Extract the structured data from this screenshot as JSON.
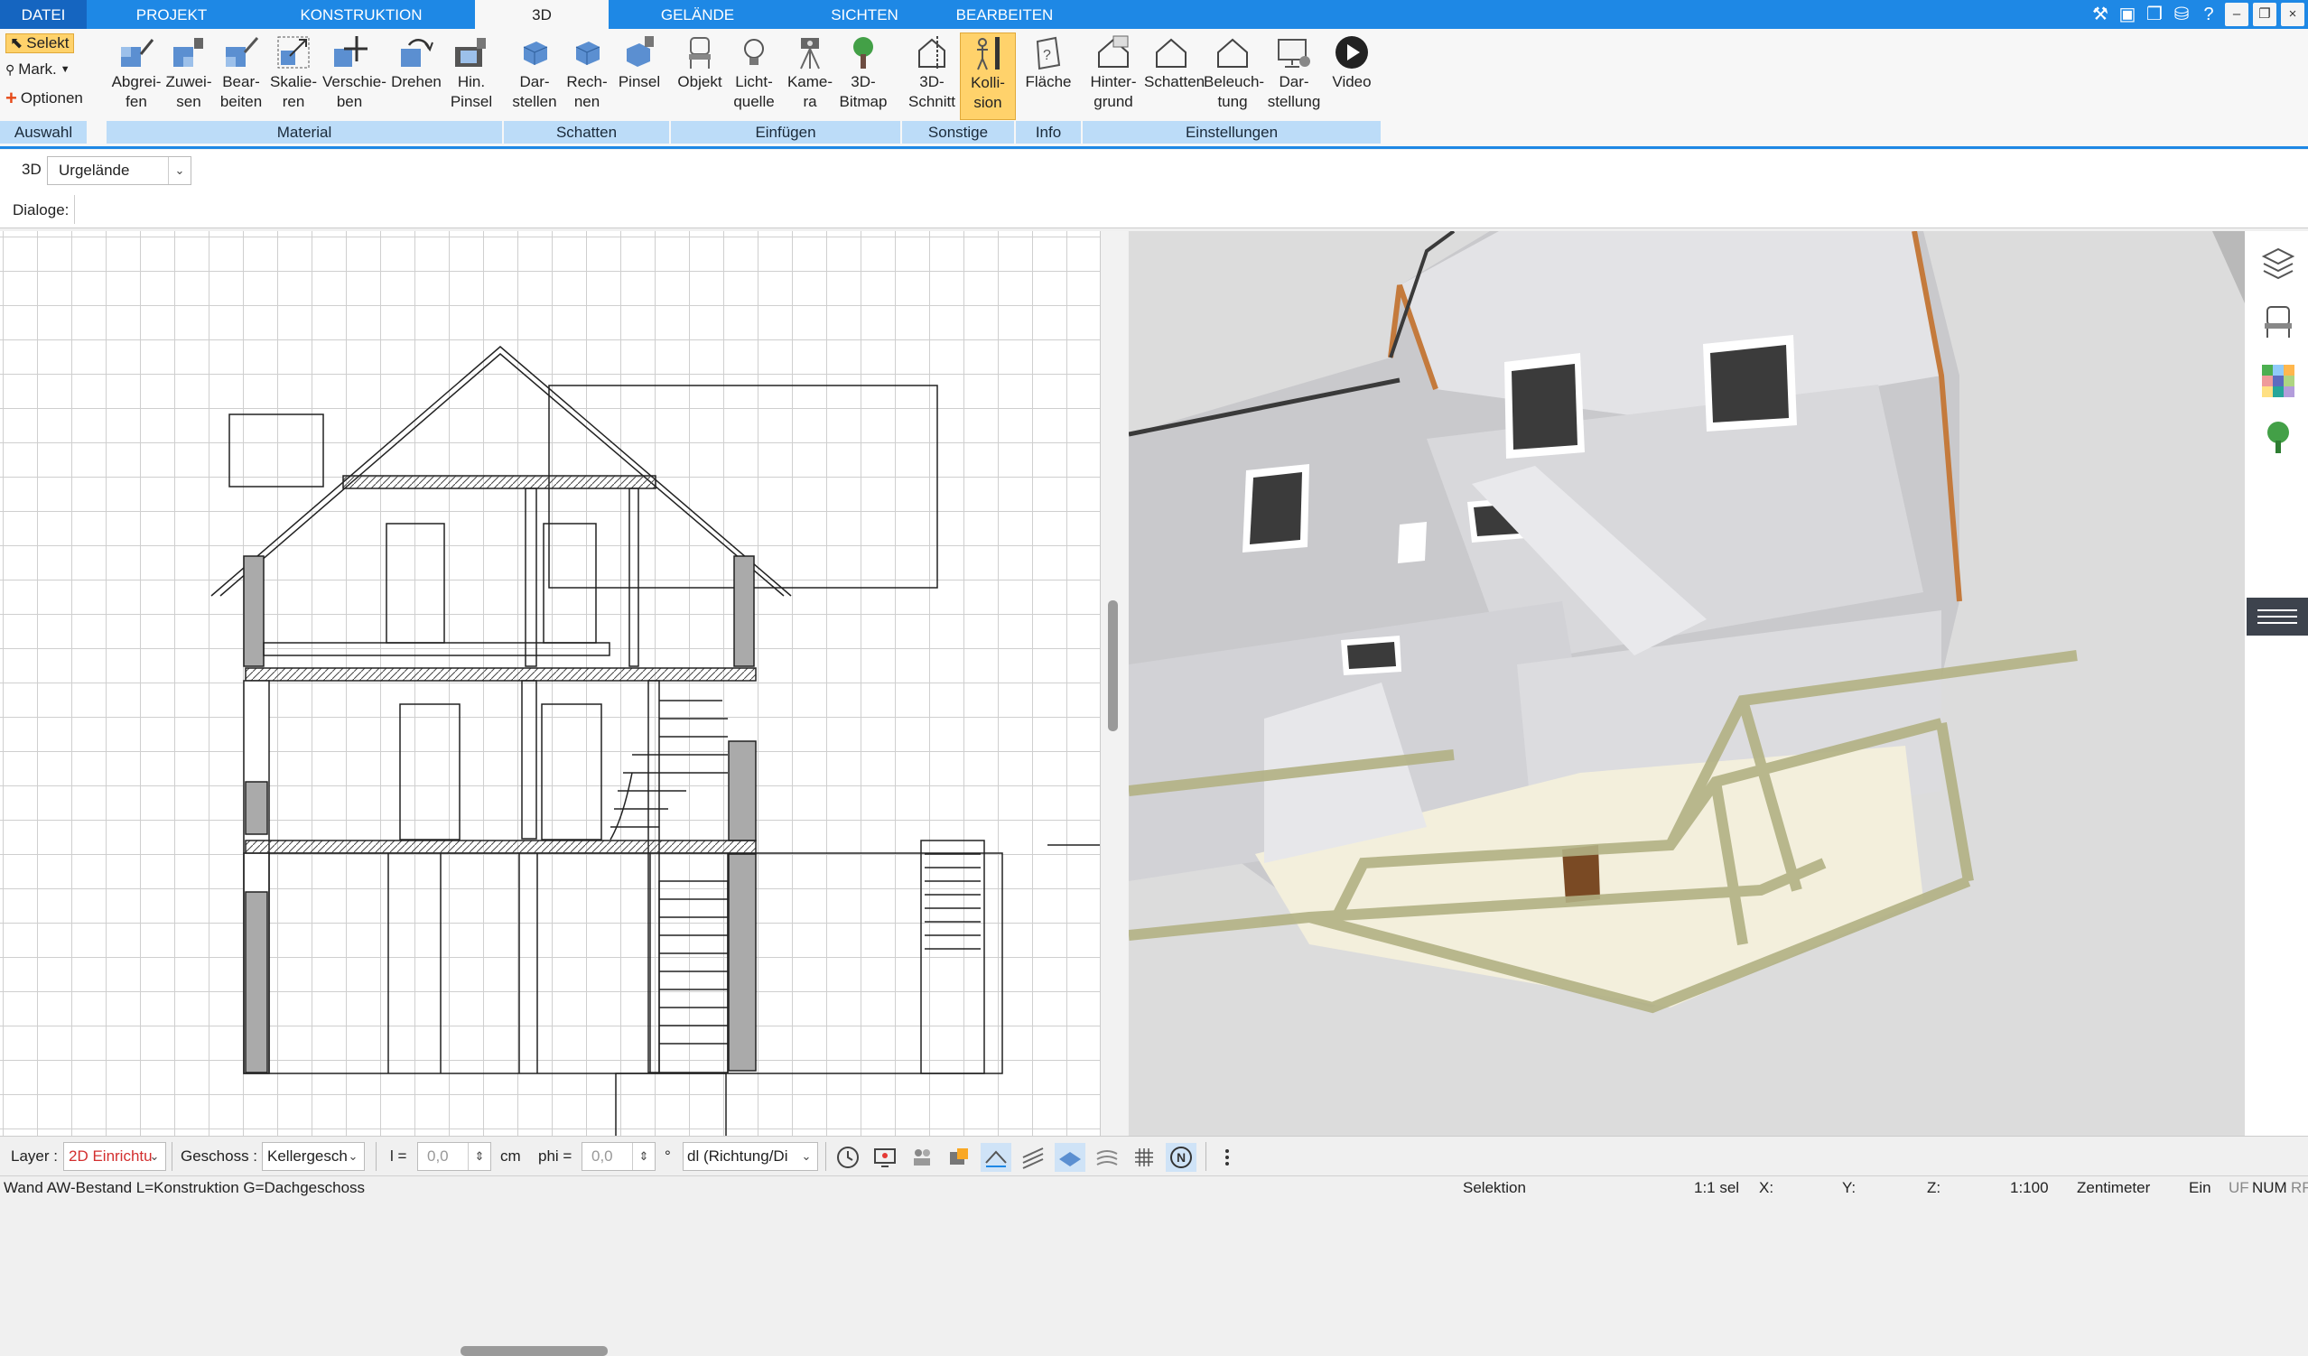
{
  "tabs": [
    "DATEI",
    "PROJEKT",
    "KONSTRUKTION",
    "3D",
    "GELÄNDE",
    "SICHTEN",
    "BEARBEITEN"
  ],
  "active_tab": "3D",
  "ribbon": {
    "auswahl": {
      "label": "Auswahl",
      "selekt": "Selekt",
      "mark": "Mark.",
      "optionen": "Optionen"
    },
    "material": {
      "label": "Material",
      "buttons": [
        "Abgrei-\nfen",
        "Zuwei-\nsen",
        "Bear-\nbeiten",
        "Skalie-\nren",
        "Verschie-\nben",
        "Drehen",
        "Hin.\nPinsel"
      ]
    },
    "schatten": {
      "label": "Schatten",
      "buttons": [
        "Dar-\nstellen",
        "Rech-\nnen",
        "Pinsel"
      ]
    },
    "einfuegen": {
      "label": "Einfügen",
      "buttons": [
        "Objekt",
        "Licht-\nquelle",
        "Kame-\nra",
        "3D-\nBitmap"
      ]
    },
    "sonstige": {
      "label": "Sonstige",
      "buttons": [
        "3D-\nSchnitt",
        "Kolli-\nsion"
      ]
    },
    "info": {
      "label": "Info",
      "buttons": [
        "Fläche"
      ]
    },
    "einstellungen": {
      "label": "Einstellungen",
      "buttons": [
        "Hinter-\ngrund",
        "Schatten",
        "Beleuch-\ntung",
        "Dar-\nstellung",
        "Video"
      ]
    }
  },
  "toolbar": {
    "mode_label": "3D",
    "terrain_value": "Urgelände",
    "dialoge_label": "Dialoge:"
  },
  "bottom": {
    "layer_label": "Layer :",
    "layer_value": "2D Einrichtu",
    "geschoss_label": "Geschoss :",
    "geschoss_value": "Kellergesch",
    "l_label": "l =",
    "l_value": "0,0",
    "cm_label": "cm",
    "phi_label": "phi =",
    "phi_value": "0,0",
    "deg_label": "°",
    "dl_value": "dl (Richtung/Di"
  },
  "status": {
    "left": "Wand AW-Bestand L=Konstruktion G=Dachgeschoss",
    "mode": "Selektion",
    "sel": "1:1 sel",
    "x": "X:",
    "y": "Y:",
    "z": "Z:",
    "scale": "1:100",
    "unit": "Zentimeter",
    "ein": "Ein",
    "uf": "UF",
    "num": "NUM",
    "rf": "RF"
  },
  "colors": {
    "accent": "#1e88e5",
    "ribbon_group": "#bcdcf8",
    "selected": "#ffd26b"
  }
}
